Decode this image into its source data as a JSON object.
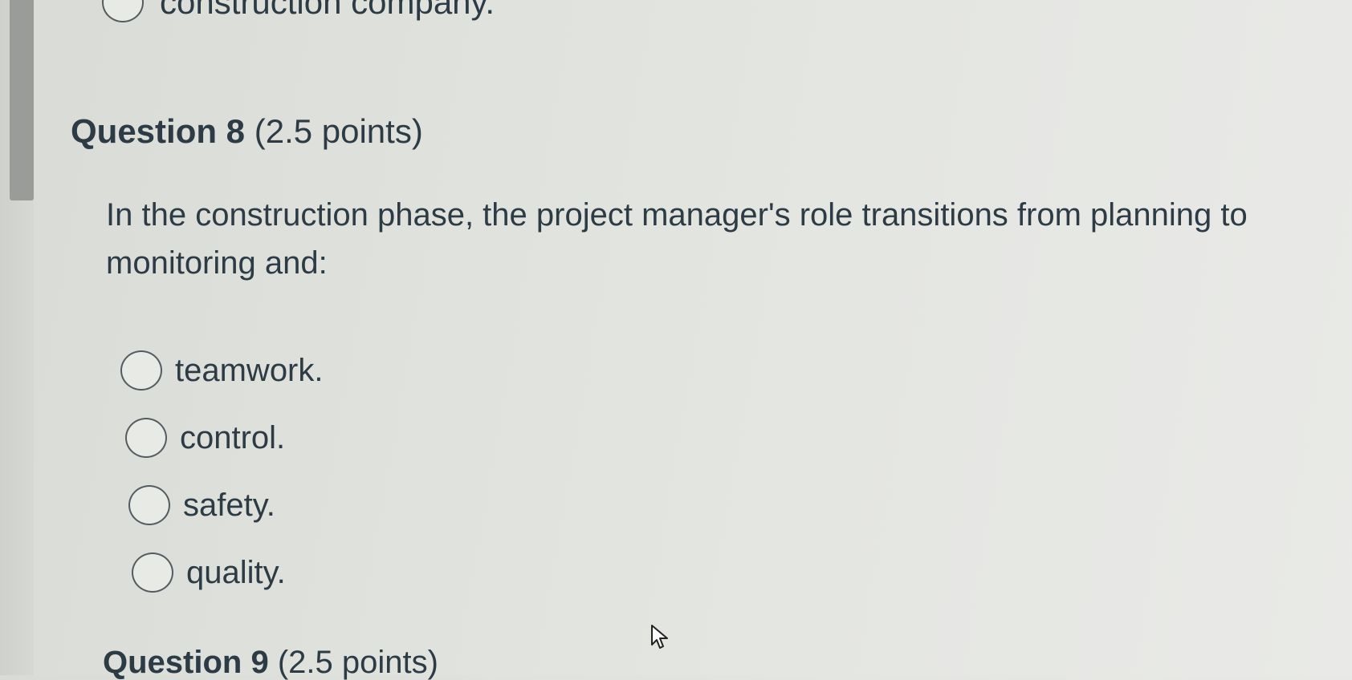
{
  "previous_question": {
    "option_label": "construction company."
  },
  "question": {
    "number_label": "Question 8",
    "points_label": "(2.5 points)",
    "text": "In the construction phase, the project manager's role transitions from planning to monitoring and:",
    "options": [
      {
        "label": "teamwork.",
        "selected": false
      },
      {
        "label": "control.",
        "selected": false
      },
      {
        "label": "safety.",
        "selected": false
      },
      {
        "label": "quality.",
        "selected": false
      }
    ]
  },
  "next_question": {
    "number_label": "Question 9",
    "points_label": "(2.5 points)"
  },
  "icons": {
    "radio": "radio-unchecked-icon",
    "cursor": "mouse-pointer-icon"
  }
}
